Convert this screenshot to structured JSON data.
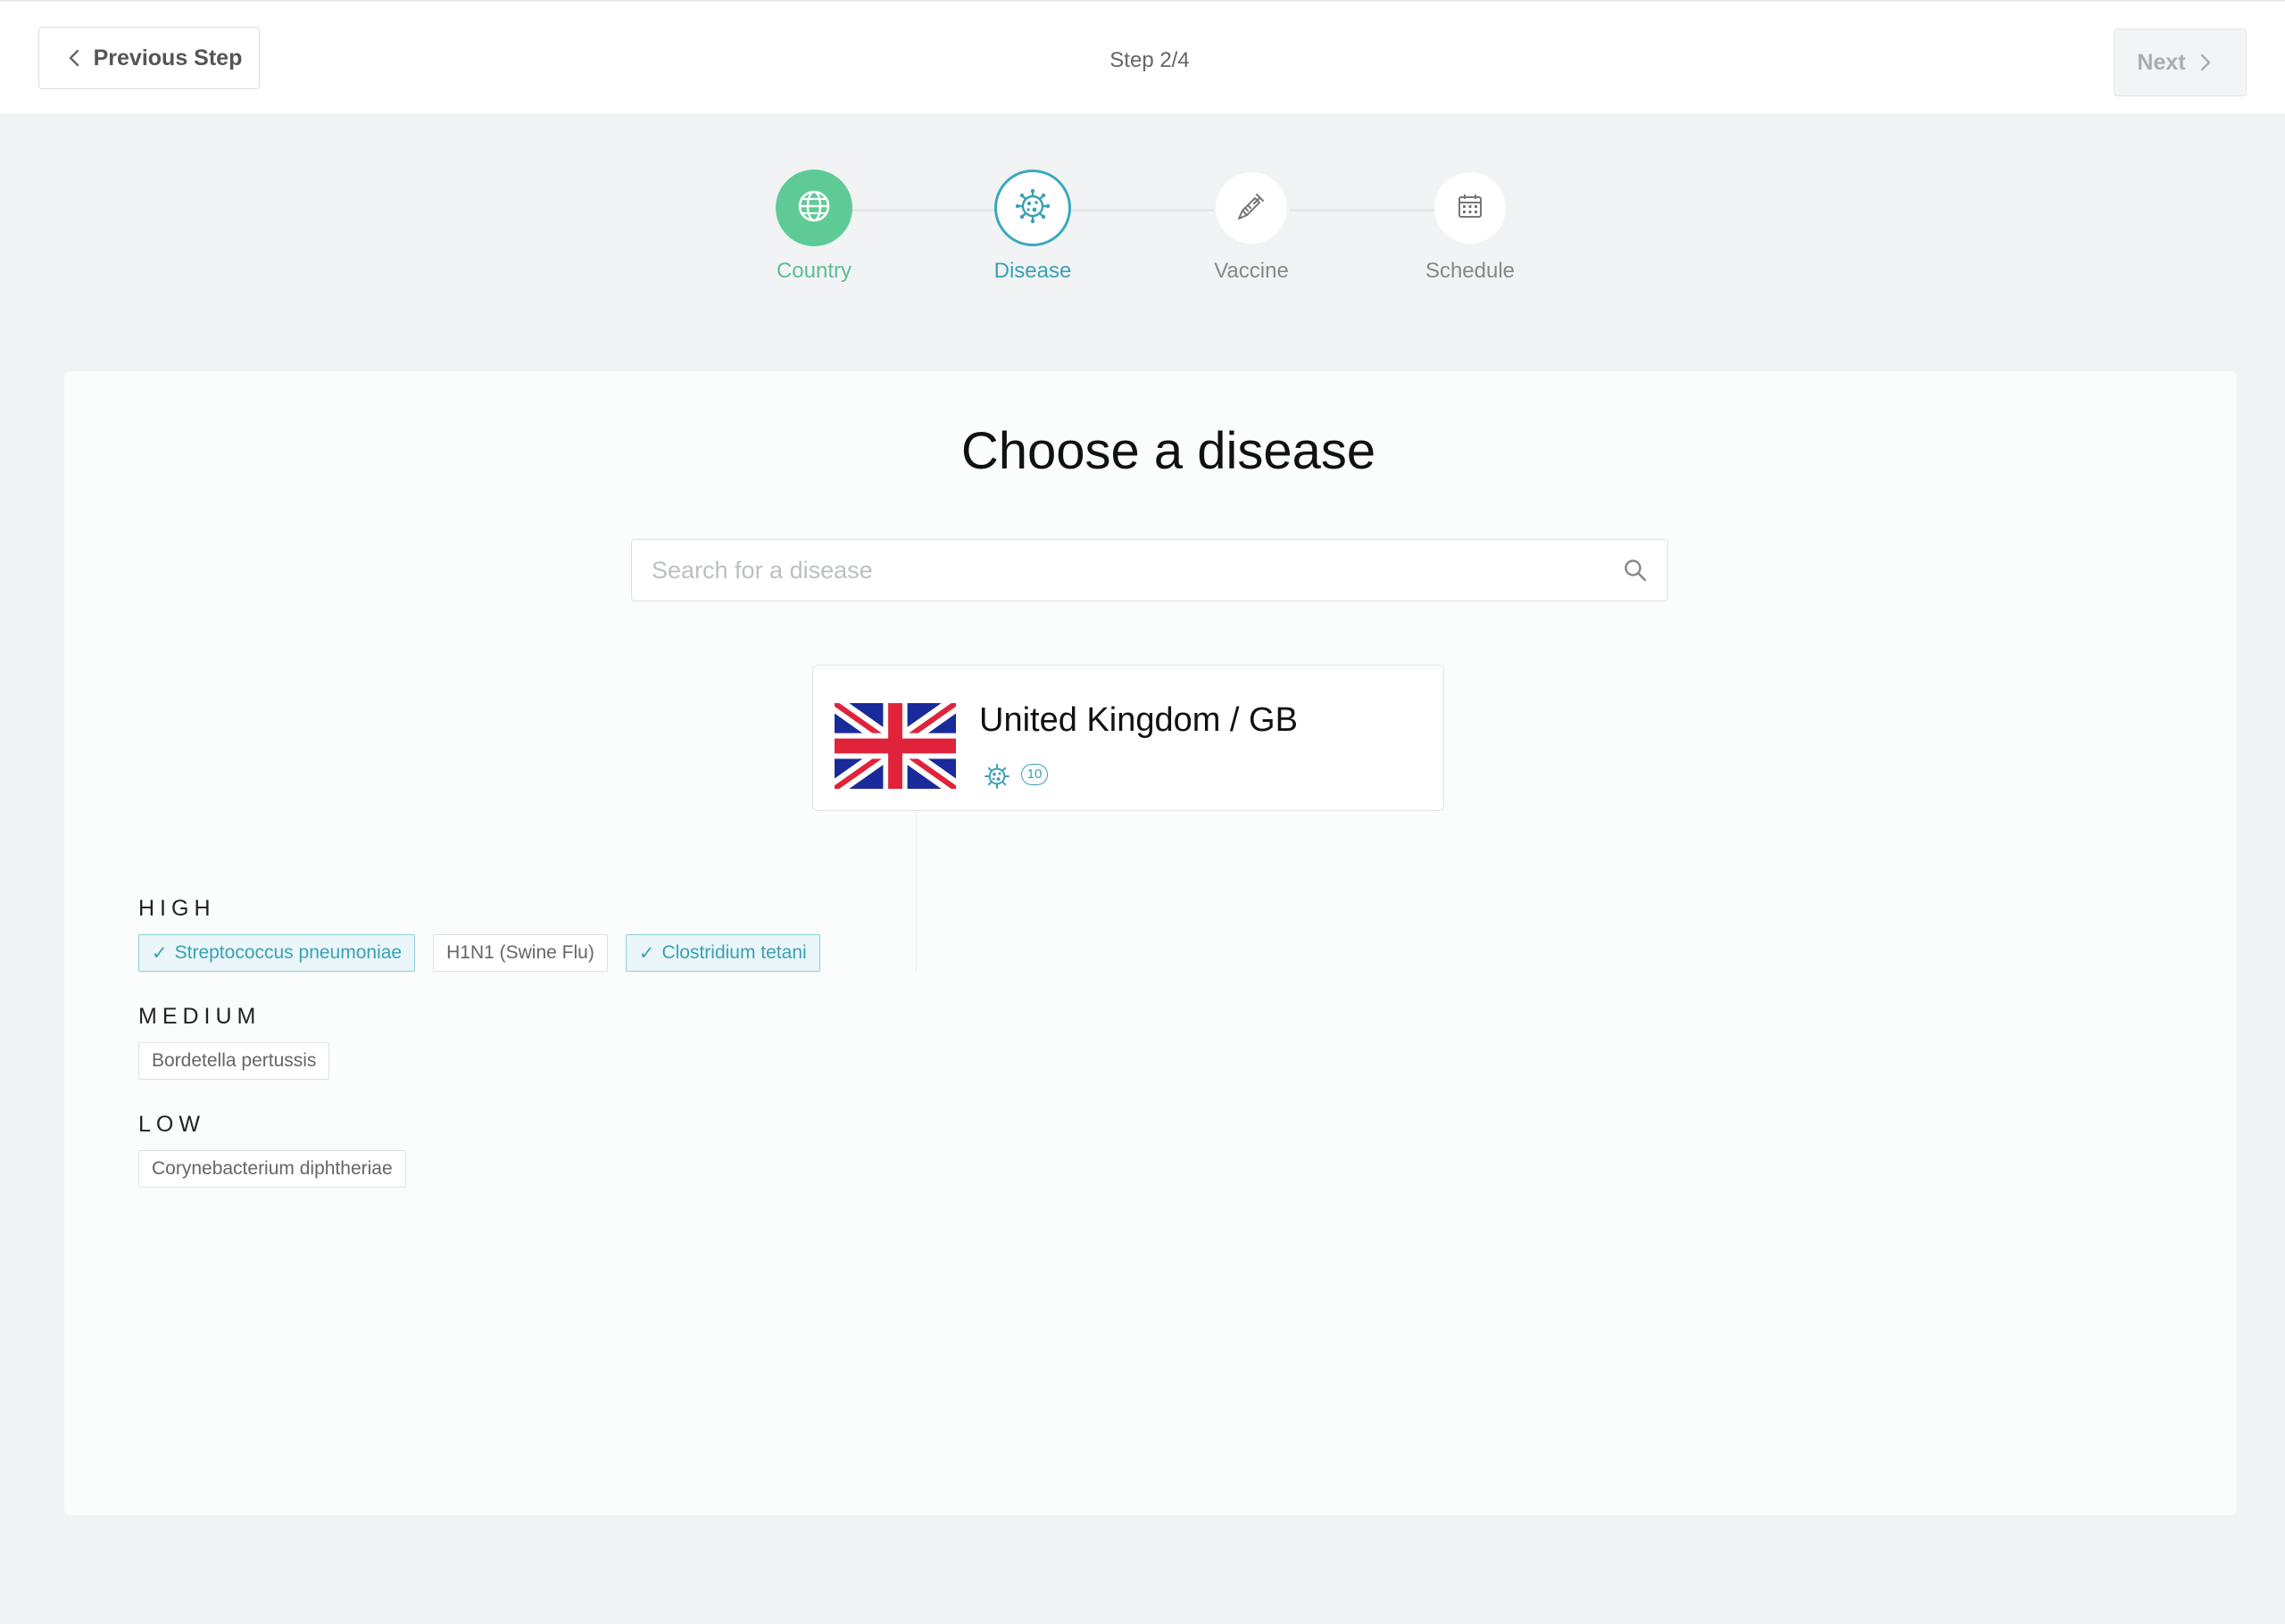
{
  "header": {
    "prev_label": "Previous Step",
    "step_text": "Step 2/4",
    "next_label": "Next"
  },
  "stepper": {
    "steps": [
      {
        "label": "Country",
        "state": "done",
        "icon": "globe-icon"
      },
      {
        "label": "Disease",
        "state": "active",
        "icon": "virus-icon"
      },
      {
        "label": "Vaccine",
        "state": "todo",
        "icon": "syringe-icon"
      },
      {
        "label": "Schedule",
        "state": "todo",
        "icon": "calendar-icon"
      }
    ]
  },
  "main": {
    "title": "Choose a disease",
    "search": {
      "placeholder": "Search for a disease",
      "value": ""
    },
    "country": {
      "name": "United Kingdom / GB",
      "disease_count": "10",
      "flag_icon": "uk-flag-icon"
    },
    "groups": [
      {
        "label": "HIGH",
        "items": [
          {
            "name": "Streptococcus pneumoniae",
            "selected": true
          },
          {
            "name": "H1N1 (Swine Flu)",
            "selected": false
          },
          {
            "name": "Clostridium tetani",
            "selected": true
          }
        ]
      },
      {
        "label": "MEDIUM",
        "items": [
          {
            "name": "Bordetella pertussis",
            "selected": false
          }
        ]
      },
      {
        "label": "LOW",
        "items": [
          {
            "name": "Corynebacterium diphtheriae",
            "selected": false
          }
        ]
      }
    ]
  },
  "colors": {
    "done": "#5ecb96",
    "active": "#3aa9bf",
    "selected_chip_bg": "#eaf6f9"
  }
}
